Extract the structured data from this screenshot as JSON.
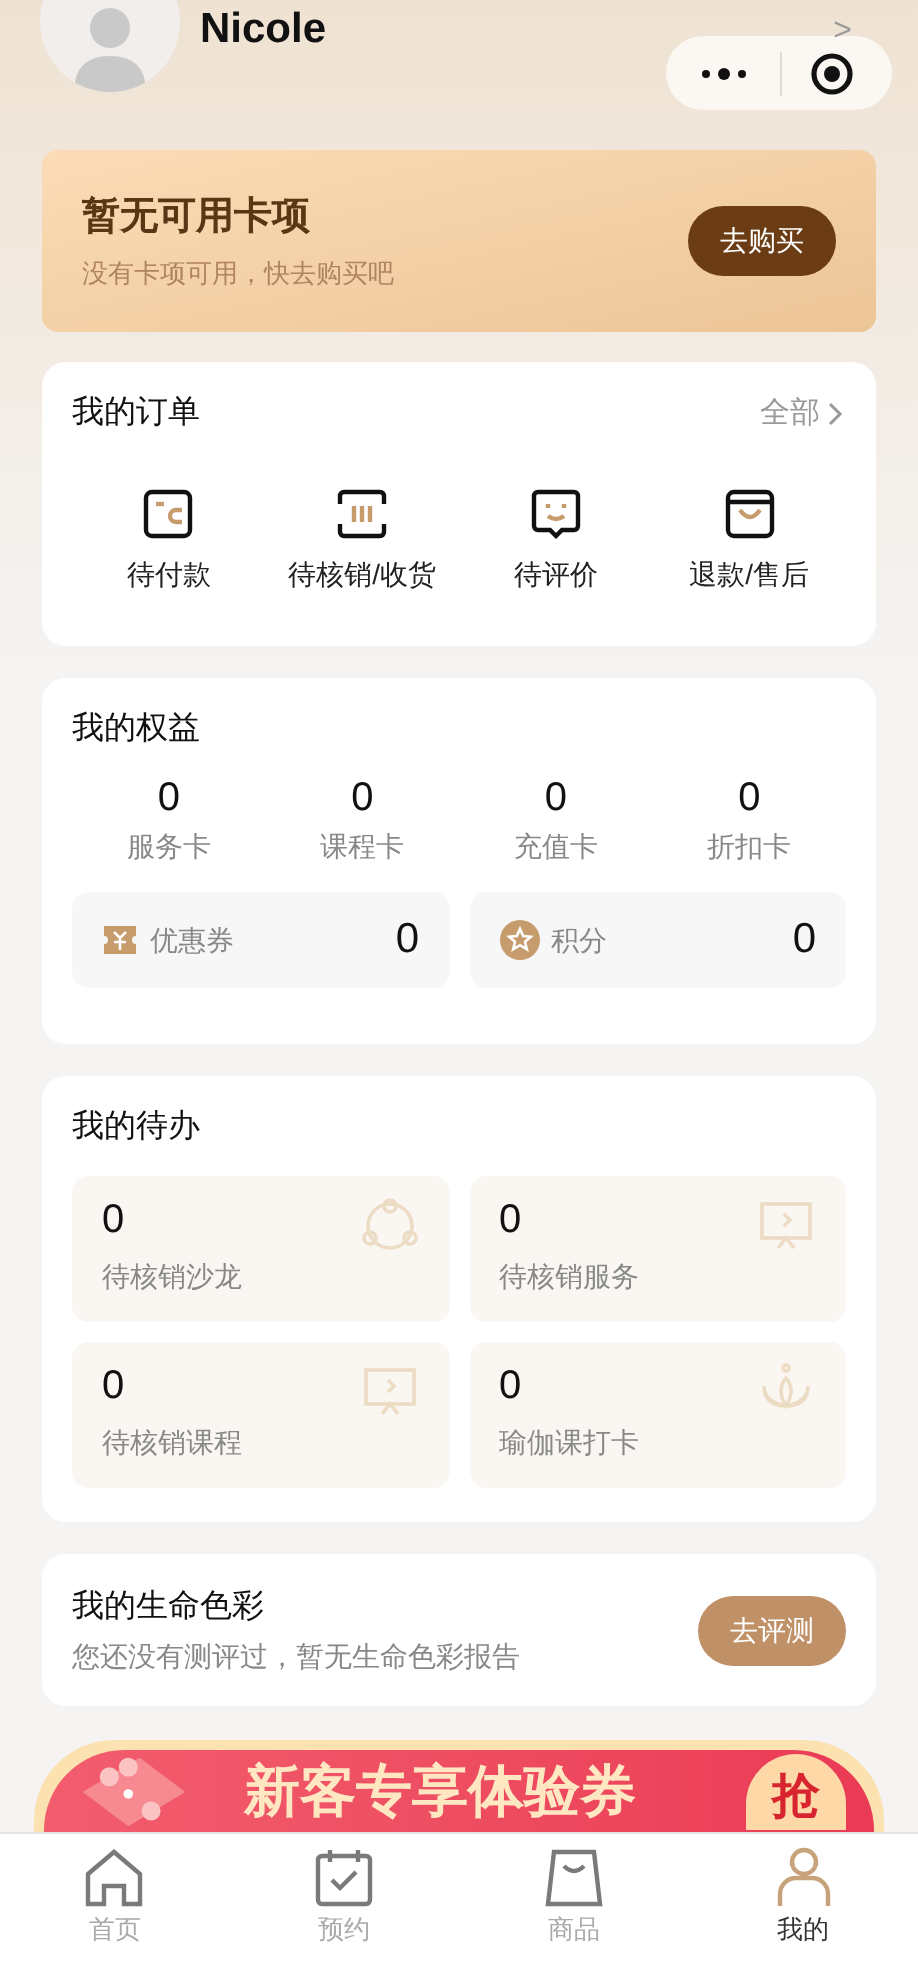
{
  "profile": {
    "name": "Nicole",
    "chevron": ">"
  },
  "card_banner": {
    "title": "暂无可用卡项",
    "subtitle": "没有卡项可用，快去购买吧",
    "button": "去购买"
  },
  "orders": {
    "title": "我的订单",
    "all_link": "全部",
    "items": [
      {
        "label": "待付款",
        "kind": "wallet"
      },
      {
        "label": "待核销/收货",
        "kind": "scan"
      },
      {
        "label": "待评价",
        "kind": "smile"
      },
      {
        "label": "退款/售后",
        "kind": "bag"
      }
    ]
  },
  "benefits": {
    "title": "我的权益",
    "stats": [
      {
        "value": "0",
        "label": "服务卡"
      },
      {
        "value": "0",
        "label": "课程卡"
      },
      {
        "value": "0",
        "label": "充值卡"
      },
      {
        "value": "0",
        "label": "折扣卡"
      }
    ],
    "tiles": [
      {
        "label": "优惠券",
        "value": "0",
        "kind": "coupon"
      },
      {
        "label": "积分",
        "value": "0",
        "kind": "points"
      }
    ]
  },
  "todo": {
    "title": "我的待办",
    "items": [
      {
        "value": "0",
        "label": "待核销沙龙",
        "kind": "group"
      },
      {
        "value": "0",
        "label": "待核销服务",
        "kind": "screen"
      },
      {
        "value": "0",
        "label": "待核销课程",
        "kind": "screen"
      },
      {
        "value": "0",
        "label": "瑜伽课打卡",
        "kind": "lotus"
      }
    ]
  },
  "life_color": {
    "title": "我的生命色彩",
    "subtitle": "您还没有测评过，暂无生命色彩报告",
    "button": "去评测"
  },
  "promo_banner": {
    "title": "新客专享体验券",
    "button": "抢"
  },
  "tab_bar": [
    {
      "label": "首页",
      "kind": "home",
      "selected": false
    },
    {
      "label": "预约",
      "kind": "calendar",
      "selected": false
    },
    {
      "label": "商品",
      "kind": "bag",
      "selected": false
    },
    {
      "label": "我的",
      "kind": "person",
      "selected": true
    }
  ]
}
